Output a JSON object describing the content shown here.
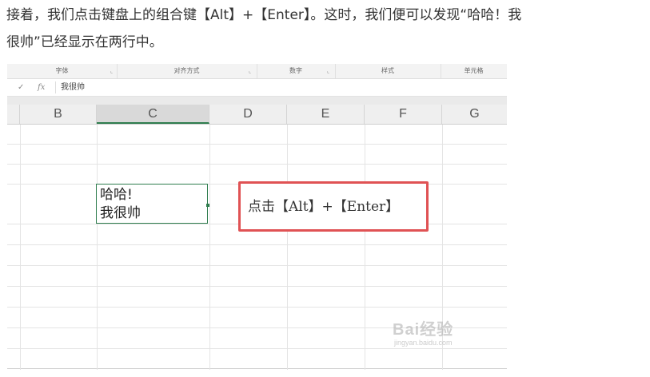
{
  "article": {
    "line1": "接着，我们点击键盘上的组合键【Alt】+【Enter】。这时，我们便可以发现“哈哈！我",
    "line2": "很帅”已经显示在两行中。"
  },
  "ribbon": {
    "groups": [
      "字体",
      "对齐方式",
      "数字",
      "样式",
      "单元格"
    ],
    "launcher_glyph": "⌞"
  },
  "formula_bar": {
    "cancel_glyph": "✓",
    "fx_label": "fx",
    "value": "我很帅"
  },
  "columns": [
    "B",
    "C",
    "D",
    "E",
    "F",
    "G"
  ],
  "active_column": "C",
  "cell": {
    "line1": "哈哈!",
    "line2": "我很帅"
  },
  "callout_text": "点击【Alt】+【Enter】",
  "watermark": {
    "text": "Bai经验",
    "sub": "jingyan.baidu.com"
  },
  "colors": {
    "selection_green": "#2f7d4e",
    "callout_red": "#e05254"
  }
}
